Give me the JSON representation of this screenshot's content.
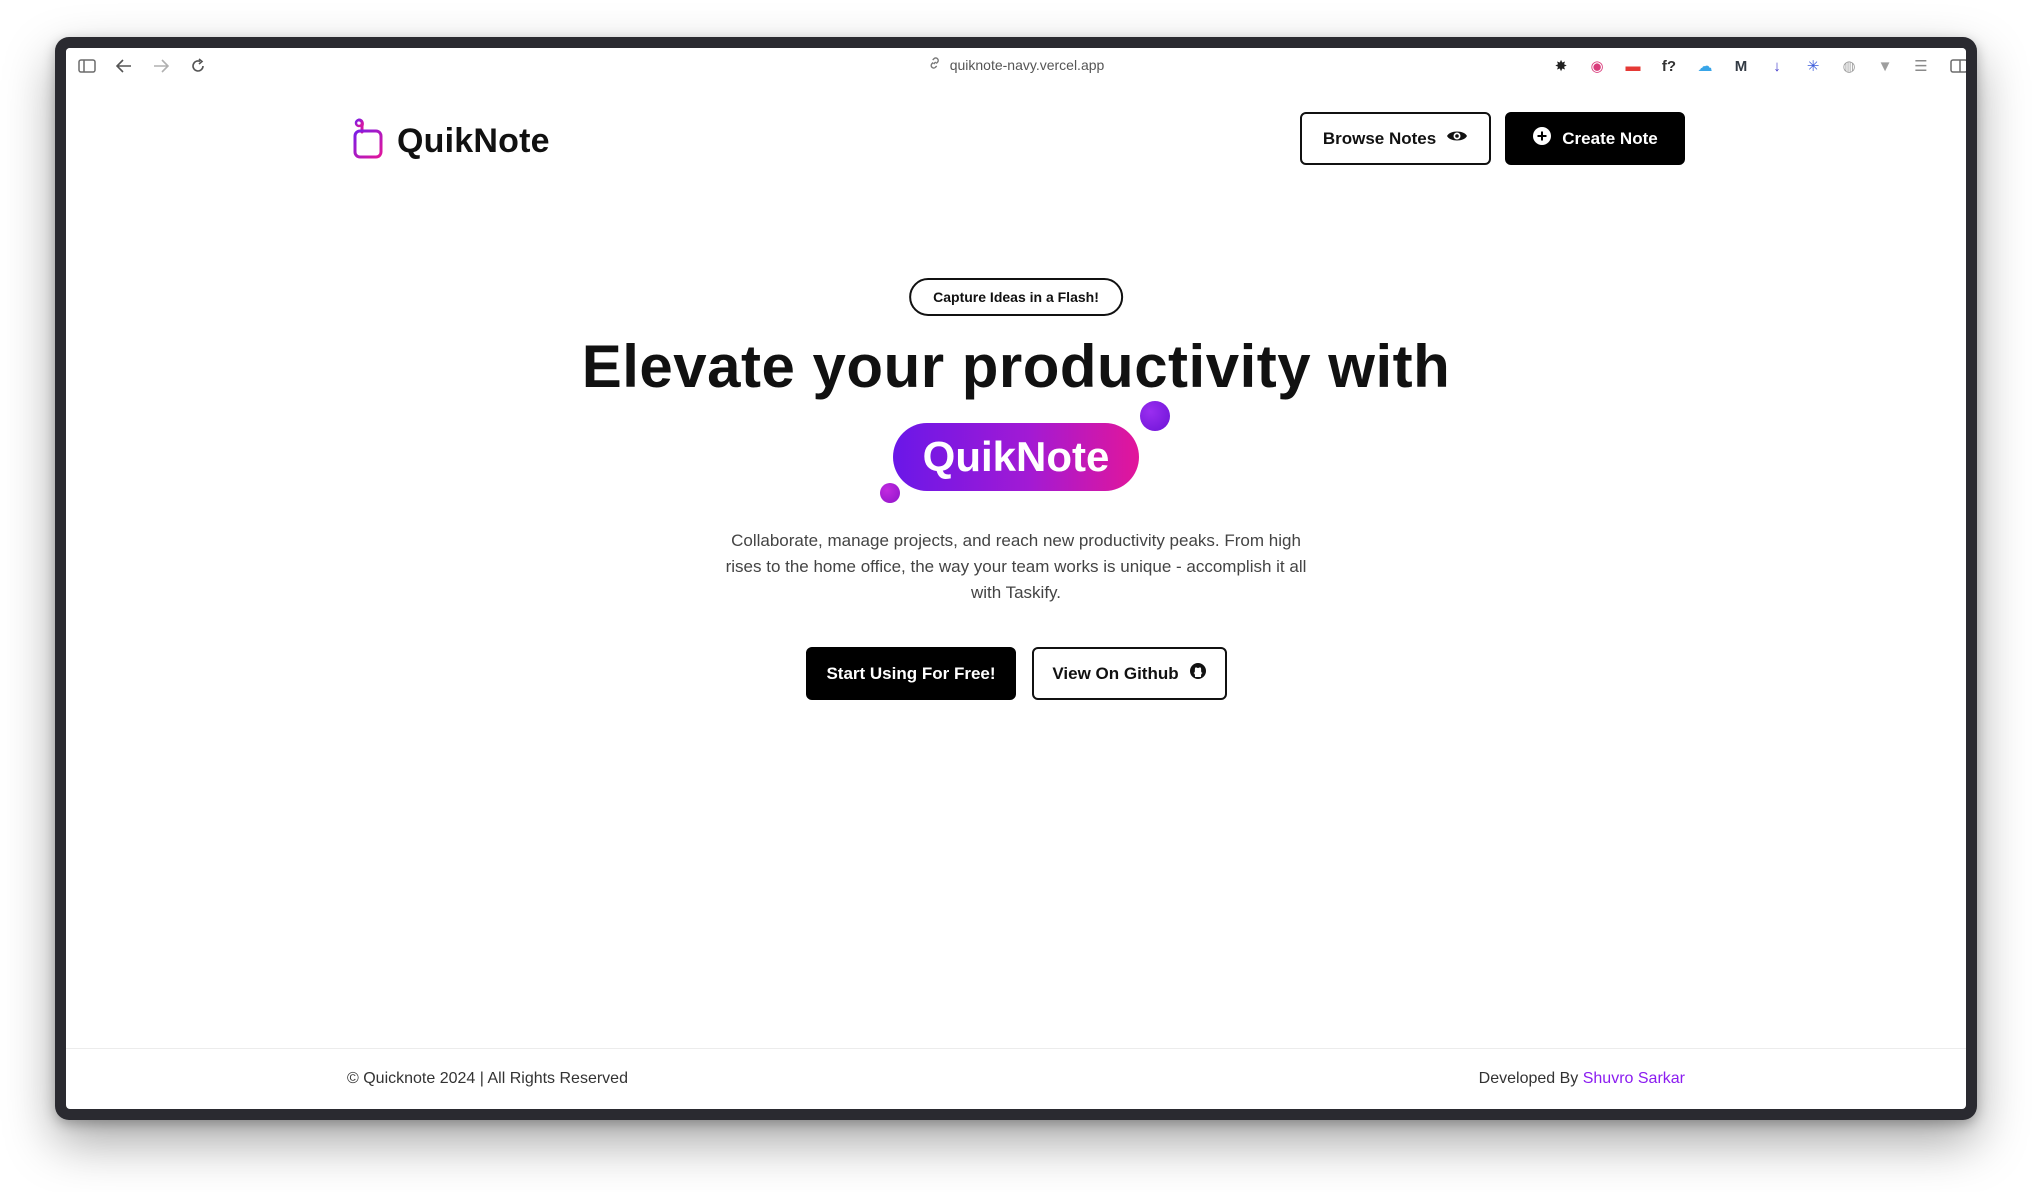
{
  "browser": {
    "url": "quiknote-navy.vercel.app",
    "extensions": [
      {
        "name": "bug-extension-icon",
        "glyph": "✸",
        "color": "#222222"
      },
      {
        "name": "color-picker-extension-icon",
        "glyph": "◉",
        "color": "#d93b7b"
      },
      {
        "name": "red-extension-icon",
        "glyph": "▬",
        "color": "#e53935"
      },
      {
        "name": "font-extension-icon",
        "glyph": "f?",
        "color": "#333333"
      },
      {
        "name": "cloud-extension-icon",
        "glyph": "☁",
        "color": "#38a5e8"
      },
      {
        "name": "m-extension-icon",
        "glyph": "M",
        "color": "#333a44"
      },
      {
        "name": "download-extension-icon",
        "glyph": "↓",
        "color": "#3f37c9"
      },
      {
        "name": "sparkle-extension-icon",
        "glyph": "✳",
        "color": "#3b5bdb"
      },
      {
        "name": "globe-extension-icon",
        "glyph": "◍",
        "color": "#9e9e9e"
      },
      {
        "name": "vue-extension-icon",
        "glyph": "▼",
        "color": "#9e9e9e"
      },
      {
        "name": "reader-extension-icon",
        "glyph": "☰",
        "color": "#8a8a8a"
      }
    ]
  },
  "nav": {
    "brand": "QuikNote",
    "browse_label": "Browse Notes",
    "create_label": "Create Note"
  },
  "hero": {
    "tagline": "Capture Ideas in a Flash!",
    "headline": "Elevate your productivity with",
    "badge": "QuikNote",
    "description": "Collaborate, manage projects, and reach new productivity peaks. From high rises to the home office, the way your team works is unique - accomplish it all with Taskify.",
    "primary_cta": "Start Using For Free!",
    "secondary_cta": "View On Github"
  },
  "footer": {
    "copyright": "© Quicknote 2024 | All Rights Reserved",
    "developed_by": "Developed By ",
    "author": "Shuvro Sarkar"
  },
  "colors": {
    "brand_gradient_start": "#6a17e8",
    "brand_gradient_end": "#e2169a",
    "author_link": "#8b1cf0"
  }
}
